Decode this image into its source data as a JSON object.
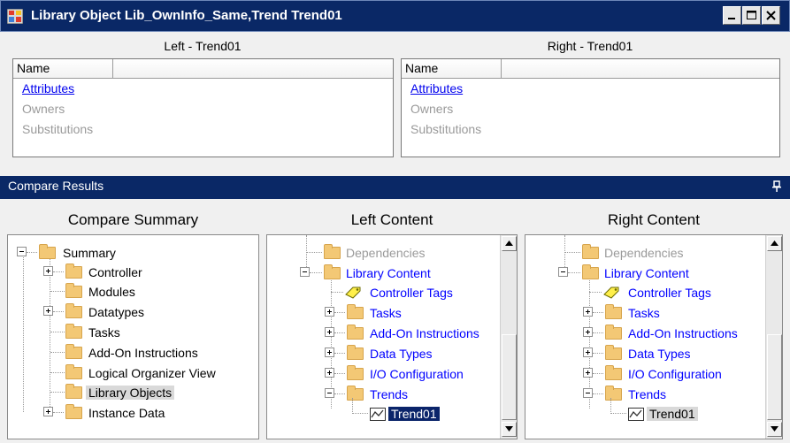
{
  "window": {
    "title": "Library Object Lib_OwnInfo_Same,Trend Trend01"
  },
  "left_pane": {
    "caption": "Left - Trend01",
    "header": "Name",
    "rows": [
      "Attributes",
      "Owners",
      "Substitutions"
    ]
  },
  "right_pane": {
    "caption": "Right - Trend01",
    "header": "Name",
    "rows": [
      "Attributes",
      "Owners",
      "Substitutions"
    ]
  },
  "compare_results": {
    "title": "Compare Results"
  },
  "summary": {
    "heading": "Compare Summary",
    "items": [
      "Summary",
      "Controller",
      "Modules",
      "Datatypes",
      "Tasks",
      "Add-On Instructions",
      "Logical Organizer View",
      "Library Objects",
      "Instance Data"
    ]
  },
  "left_content": {
    "heading": "Left Content",
    "items": [
      "Dependencies",
      "Library Content",
      "Controller Tags",
      "Tasks",
      "Add-On Instructions",
      "Data Types",
      "I/O Configuration",
      "Trends",
      "Trend01"
    ]
  },
  "right_content": {
    "heading": "Right Content",
    "items": [
      "Dependencies",
      "Library Content",
      "Controller Tags",
      "Tasks",
      "Add-On Instructions",
      "Data Types",
      "I/O Configuration",
      "Trends",
      "Trend01"
    ]
  },
  "colors": {
    "titlebar": "#0a2866",
    "link": "#0000ee",
    "tree_text_changed": "#0000ff",
    "selection": "#0a246a"
  }
}
